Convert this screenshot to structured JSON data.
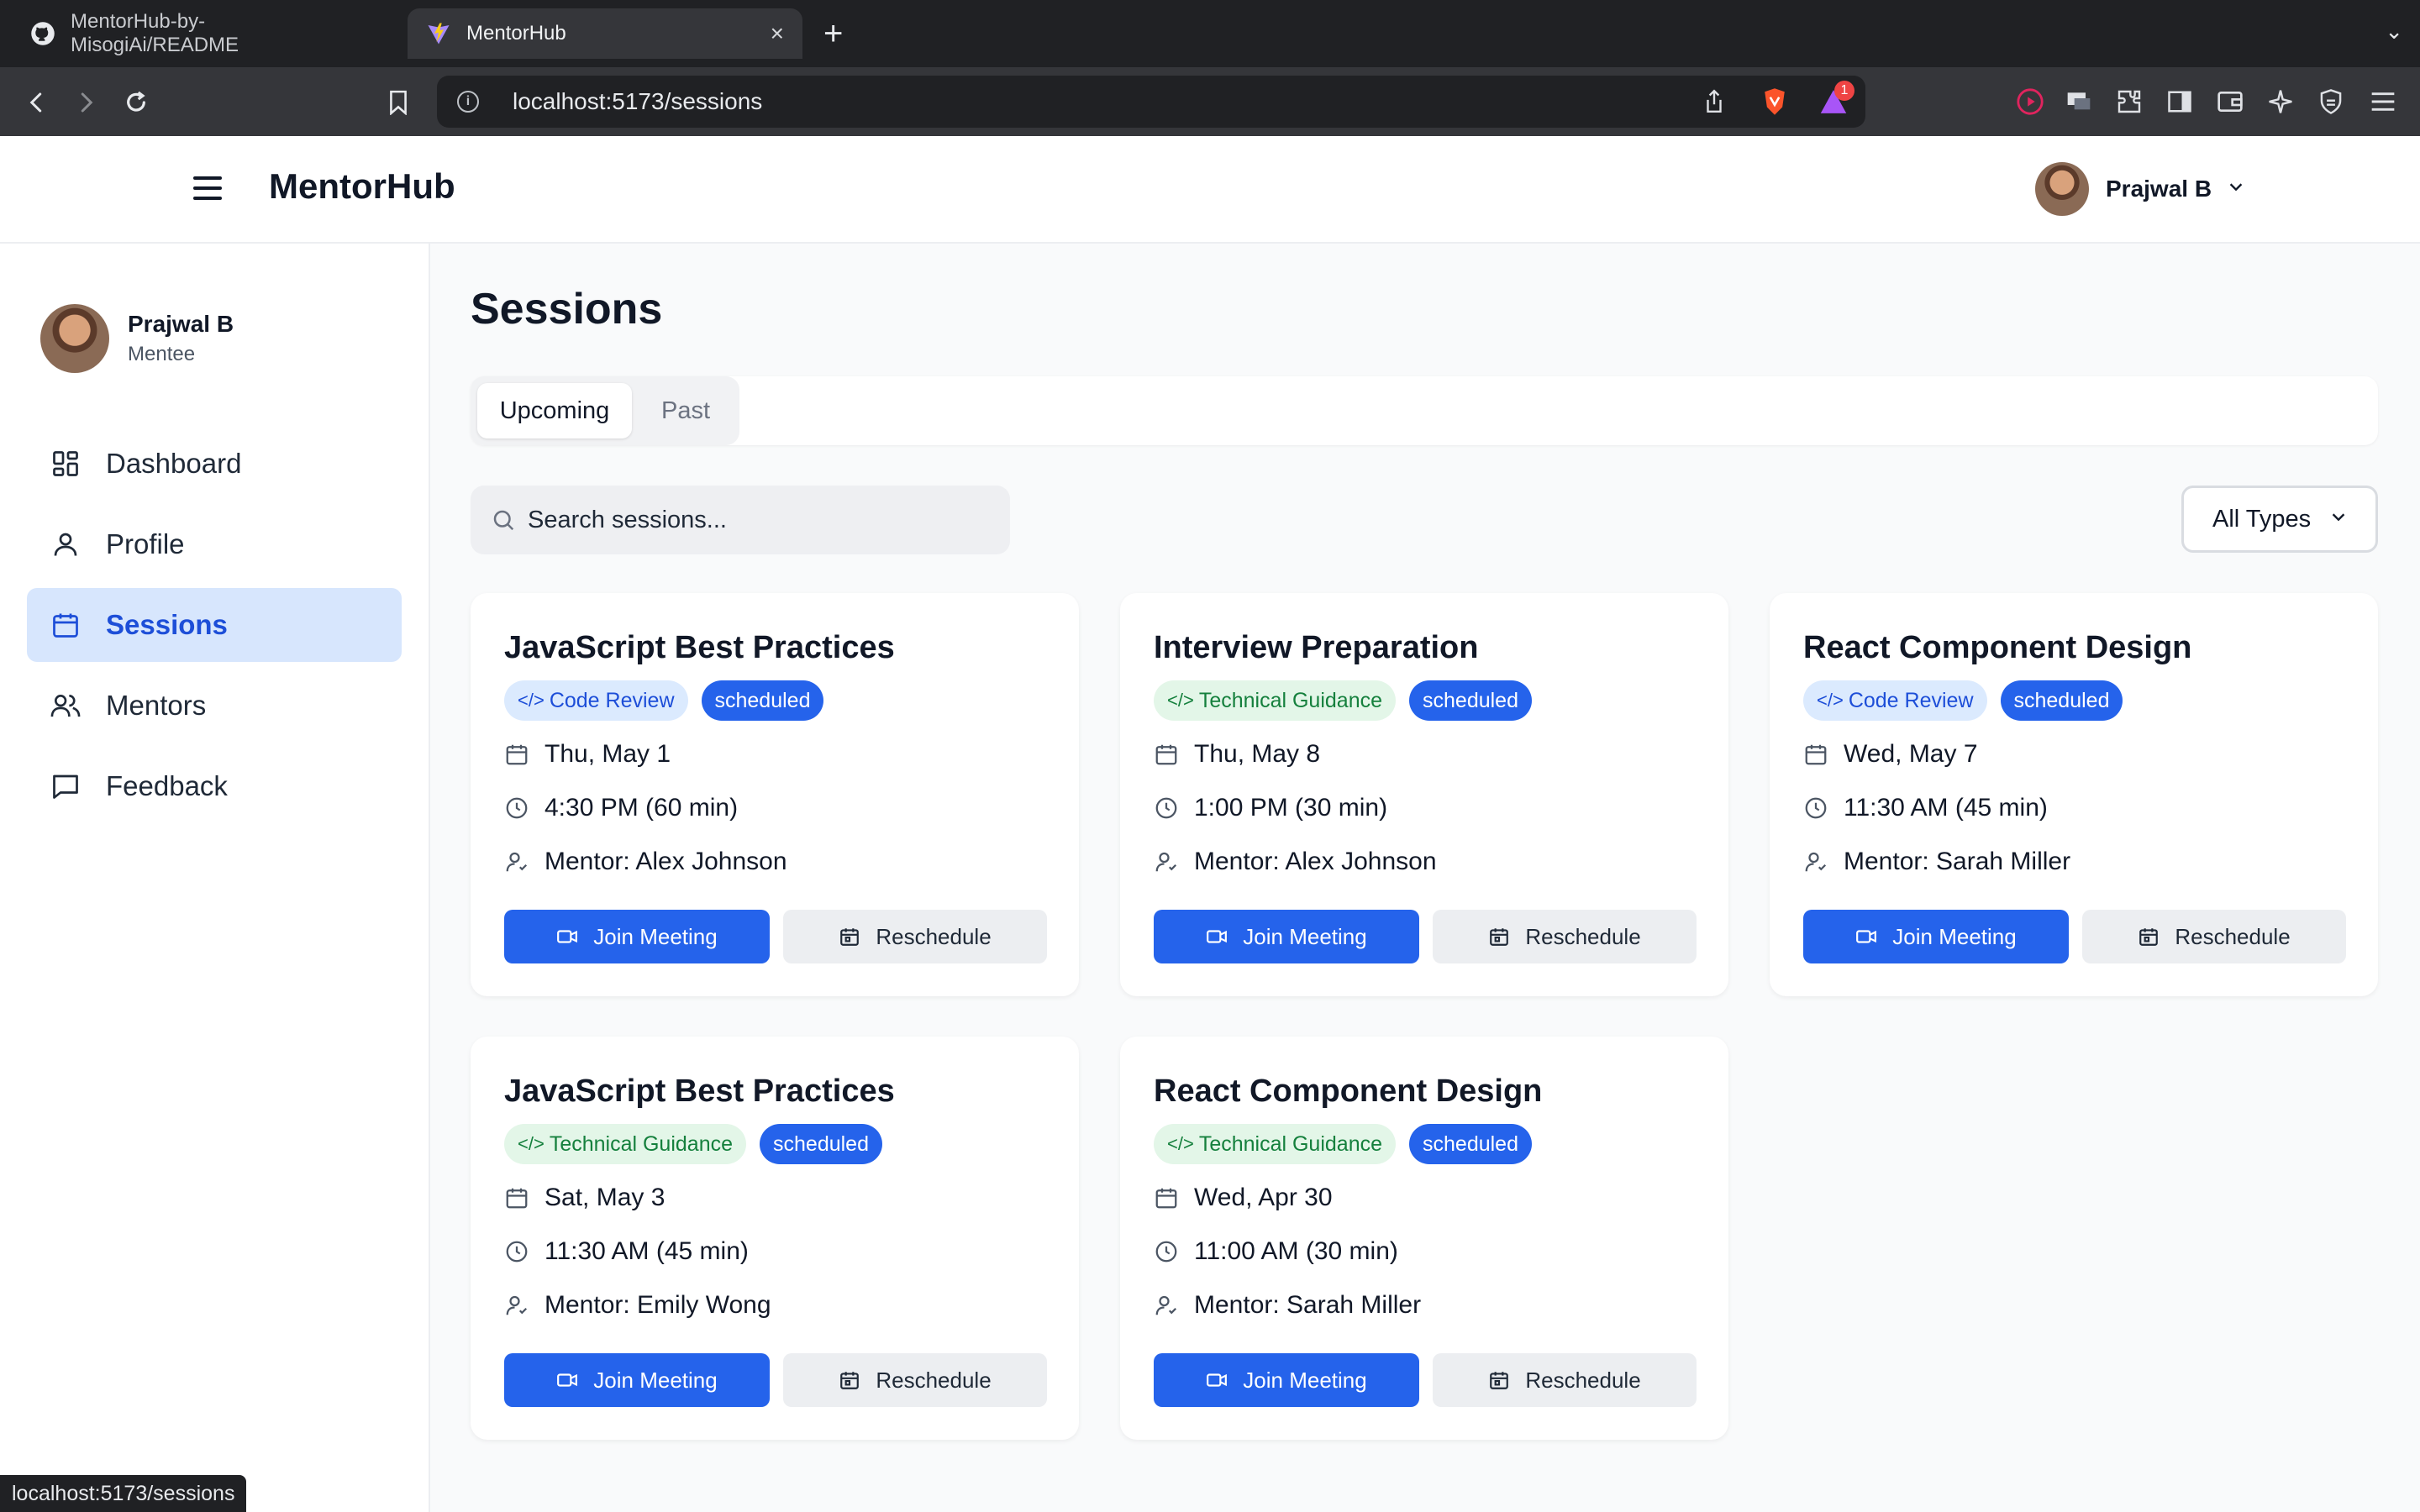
{
  "browser": {
    "tabs": [
      {
        "label": "MentorHub-by-MisogiAi/README",
        "icon": "github-icon"
      },
      {
        "label": "MentorHub",
        "icon": "vite-icon"
      }
    ],
    "url": "localhost:5173/sessions",
    "status_url": "localhost:5173/sessions",
    "notification_count": "1"
  },
  "header": {
    "brand": "MentorHub",
    "user_name": "Prajwal B"
  },
  "sidebar": {
    "user_name": "Prajwal B",
    "user_role": "Mentee",
    "items": [
      {
        "label": "Dashboard",
        "icon": "dashboard-icon"
      },
      {
        "label": "Profile",
        "icon": "user-icon"
      },
      {
        "label": "Sessions",
        "icon": "calendar-icon"
      },
      {
        "label": "Mentors",
        "icon": "users-icon"
      },
      {
        "label": "Feedback",
        "icon": "message-icon"
      }
    ]
  },
  "main": {
    "title": "Sessions",
    "tabs": [
      "Upcoming",
      "Past"
    ],
    "search_placeholder": "Search sessions...",
    "filter_label": "All Types",
    "sessions": [
      {
        "title": "JavaScript Best Practices",
        "type": "Code Review",
        "status": "scheduled",
        "date": "Thu, May 1",
        "time": "4:30 PM (60 min)",
        "mentor": "Mentor: Alex Johnson",
        "join": "Join Meeting",
        "reschedule": "Reschedule"
      },
      {
        "title": "Interview Preparation",
        "type": "Technical Guidance",
        "status": "scheduled",
        "date": "Thu, May 8",
        "time": "1:00 PM (30 min)",
        "mentor": "Mentor: Alex Johnson",
        "join": "Join Meeting",
        "reschedule": "Reschedule"
      },
      {
        "title": "React Component Design",
        "type": "Code Review",
        "status": "scheduled",
        "date": "Wed, May 7",
        "time": "11:30 AM (45 min)",
        "mentor": "Mentor: Sarah Miller",
        "join": "Join Meeting",
        "reschedule": "Reschedule"
      },
      {
        "title": "JavaScript Best Practices",
        "type": "Technical Guidance",
        "status": "scheduled",
        "date": "Sat, May 3",
        "time": "11:30 AM (45 min)",
        "mentor": "Mentor: Emily Wong",
        "join": "Join Meeting",
        "reschedule": "Reschedule"
      },
      {
        "title": "React Component Design",
        "type": "Technical Guidance",
        "status": "scheduled",
        "date": "Wed, Apr 30",
        "time": "11:00 AM (30 min)",
        "mentor": "Mentor: Sarah Miller",
        "join": "Join Meeting",
        "reschedule": "Reschedule"
      }
    ]
  },
  "colors": {
    "primary": "#2563eb",
    "active_nav_bg": "#d7e6fd",
    "code_review_badge": "#dbeafe",
    "technical_guidance_badge": "#e3f6e8"
  }
}
